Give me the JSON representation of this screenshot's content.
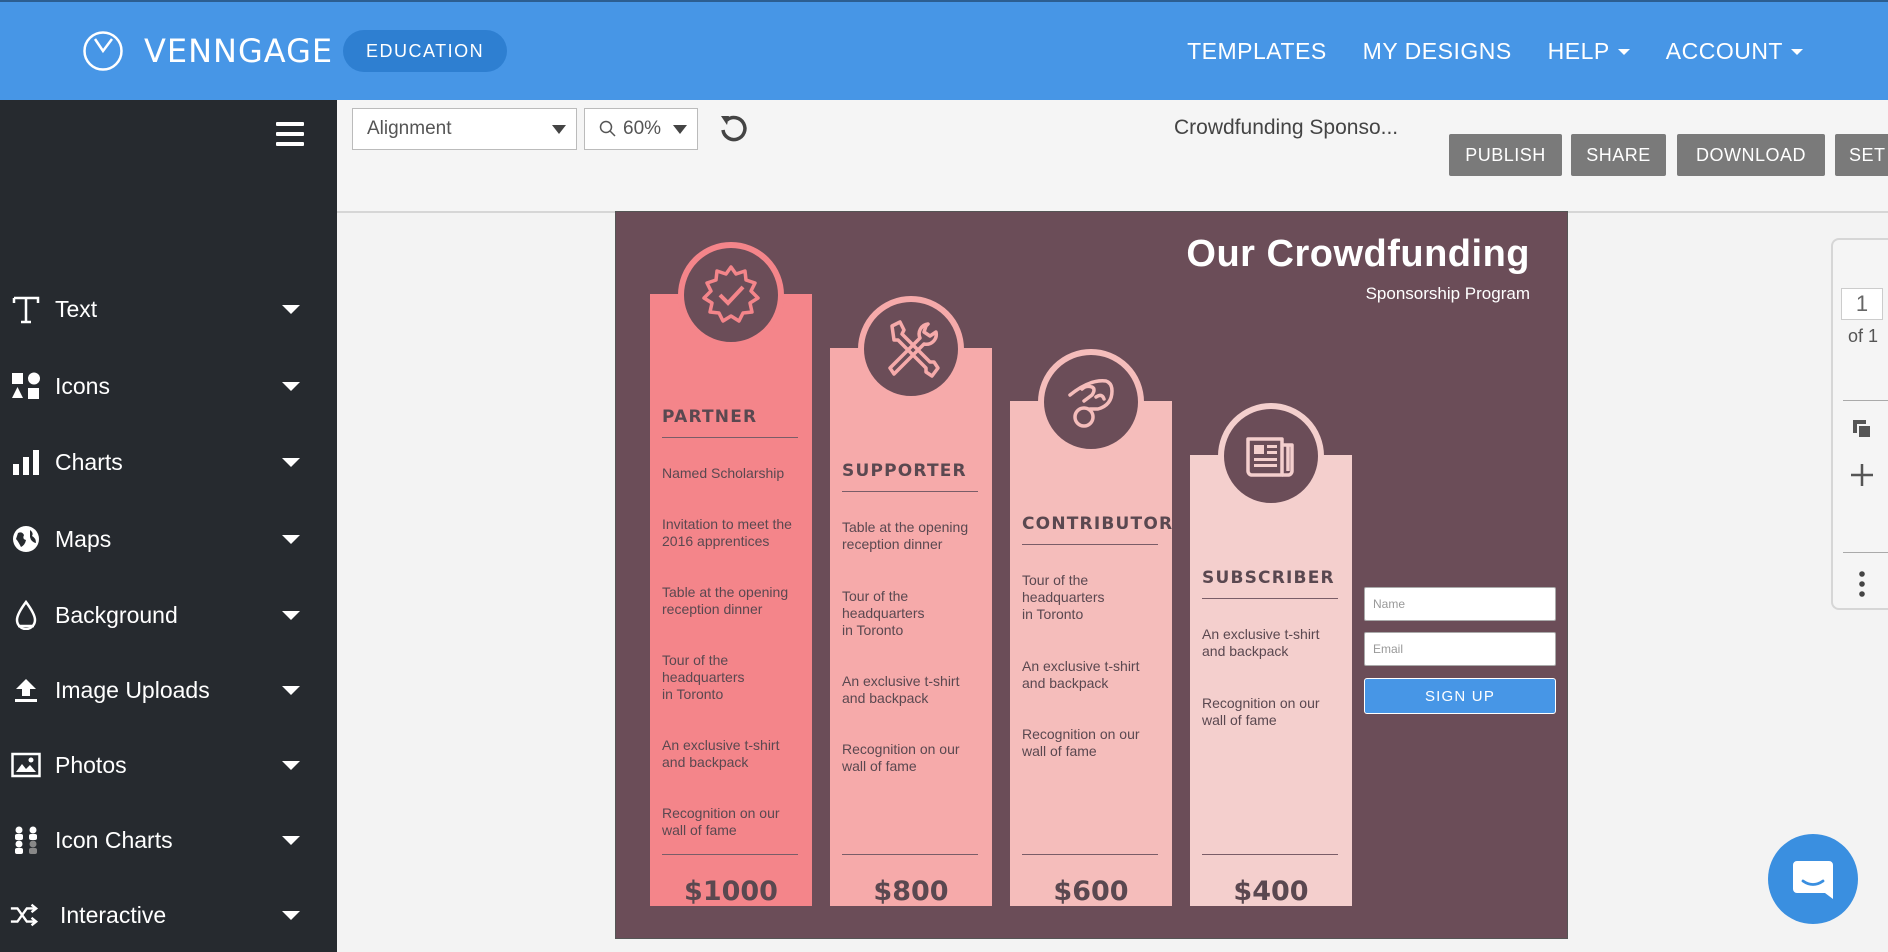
{
  "app": {
    "brand": "VENNGAGE",
    "badge": "EDUCATION",
    "nav": [
      {
        "label": "TEMPLATES",
        "dropdown": false
      },
      {
        "label": "MY DESIGNS",
        "dropdown": false
      },
      {
        "label": "HELP",
        "dropdown": true
      },
      {
        "label": "ACCOUNT",
        "dropdown": true
      }
    ]
  },
  "sidebar": {
    "items": [
      {
        "label": "Text",
        "icon": "text-icon"
      },
      {
        "label": "Icons",
        "icon": "shapes-icon"
      },
      {
        "label": "Charts",
        "icon": "bar-chart-icon"
      },
      {
        "label": "Maps",
        "icon": "globe-icon"
      },
      {
        "label": "Background",
        "icon": "droplet-icon"
      },
      {
        "label": "Image Uploads",
        "icon": "upload-icon"
      },
      {
        "label": "Photos",
        "icon": "image-icon"
      },
      {
        "label": "Icon Charts",
        "icon": "people-icon"
      },
      {
        "label": "Interactive",
        "icon": "shuffle-icon"
      }
    ]
  },
  "toolbar": {
    "alignment": "Alignment",
    "zoom": "60%",
    "doc_title": "Crowdfunding Sponso...",
    "buttons": {
      "publish": "PUBLISH",
      "share": "SHARE",
      "download": "DOWNLOAD",
      "settings": "SET"
    }
  },
  "design": {
    "title": "Our Crowdfunding",
    "subtitle": "Sponsorship Program",
    "tiers": [
      {
        "name": "PARTNER",
        "price": "$1000",
        "color": "#f4858a",
        "icon": "badge-check-icon",
        "benefits": [
          "Named Scholarship",
          "Invitation to meet the\n2016 apprentices",
          "Table at the opening\nreception dinner",
          "Tour of the\nheadquarters\nin Toronto",
          "An exclusive t-shirt\nand backpack",
          "Recognition on our\nwall of fame"
        ]
      },
      {
        "name": "SUPPORTER",
        "price": "$800",
        "color": "#f6aaaa",
        "icon": "tools-icon",
        "benefits": [
          "Table at the opening\nreception dinner",
          "Tour of the\nheadquarters\nin Toronto",
          "An exclusive t-shirt\nand backpack",
          "Recognition on our\nwall of fame"
        ]
      },
      {
        "name": "CONTRIBUTOR",
        "price": "$600",
        "color": "#f5bdbb",
        "icon": "hand-coin-icon",
        "benefits": [
          "Tour of the\nheadquarters\nin Toronto",
          "An exclusive t-shirt\nand backpack",
          "Recognition on our\nwall of fame"
        ]
      },
      {
        "name": "SUBSCRIBER",
        "price": "$400",
        "color": "#f4cfcd",
        "icon": "newspaper-icon",
        "benefits": [
          "An exclusive t-shirt\nand backpack",
          "Recognition on our\nwall of fame"
        ]
      }
    ],
    "form": {
      "name_placeholder": "Name",
      "email_placeholder": "Email",
      "submit": "SIGN UP"
    }
  },
  "pages": {
    "current": "1",
    "total_label": "of 1"
  }
}
